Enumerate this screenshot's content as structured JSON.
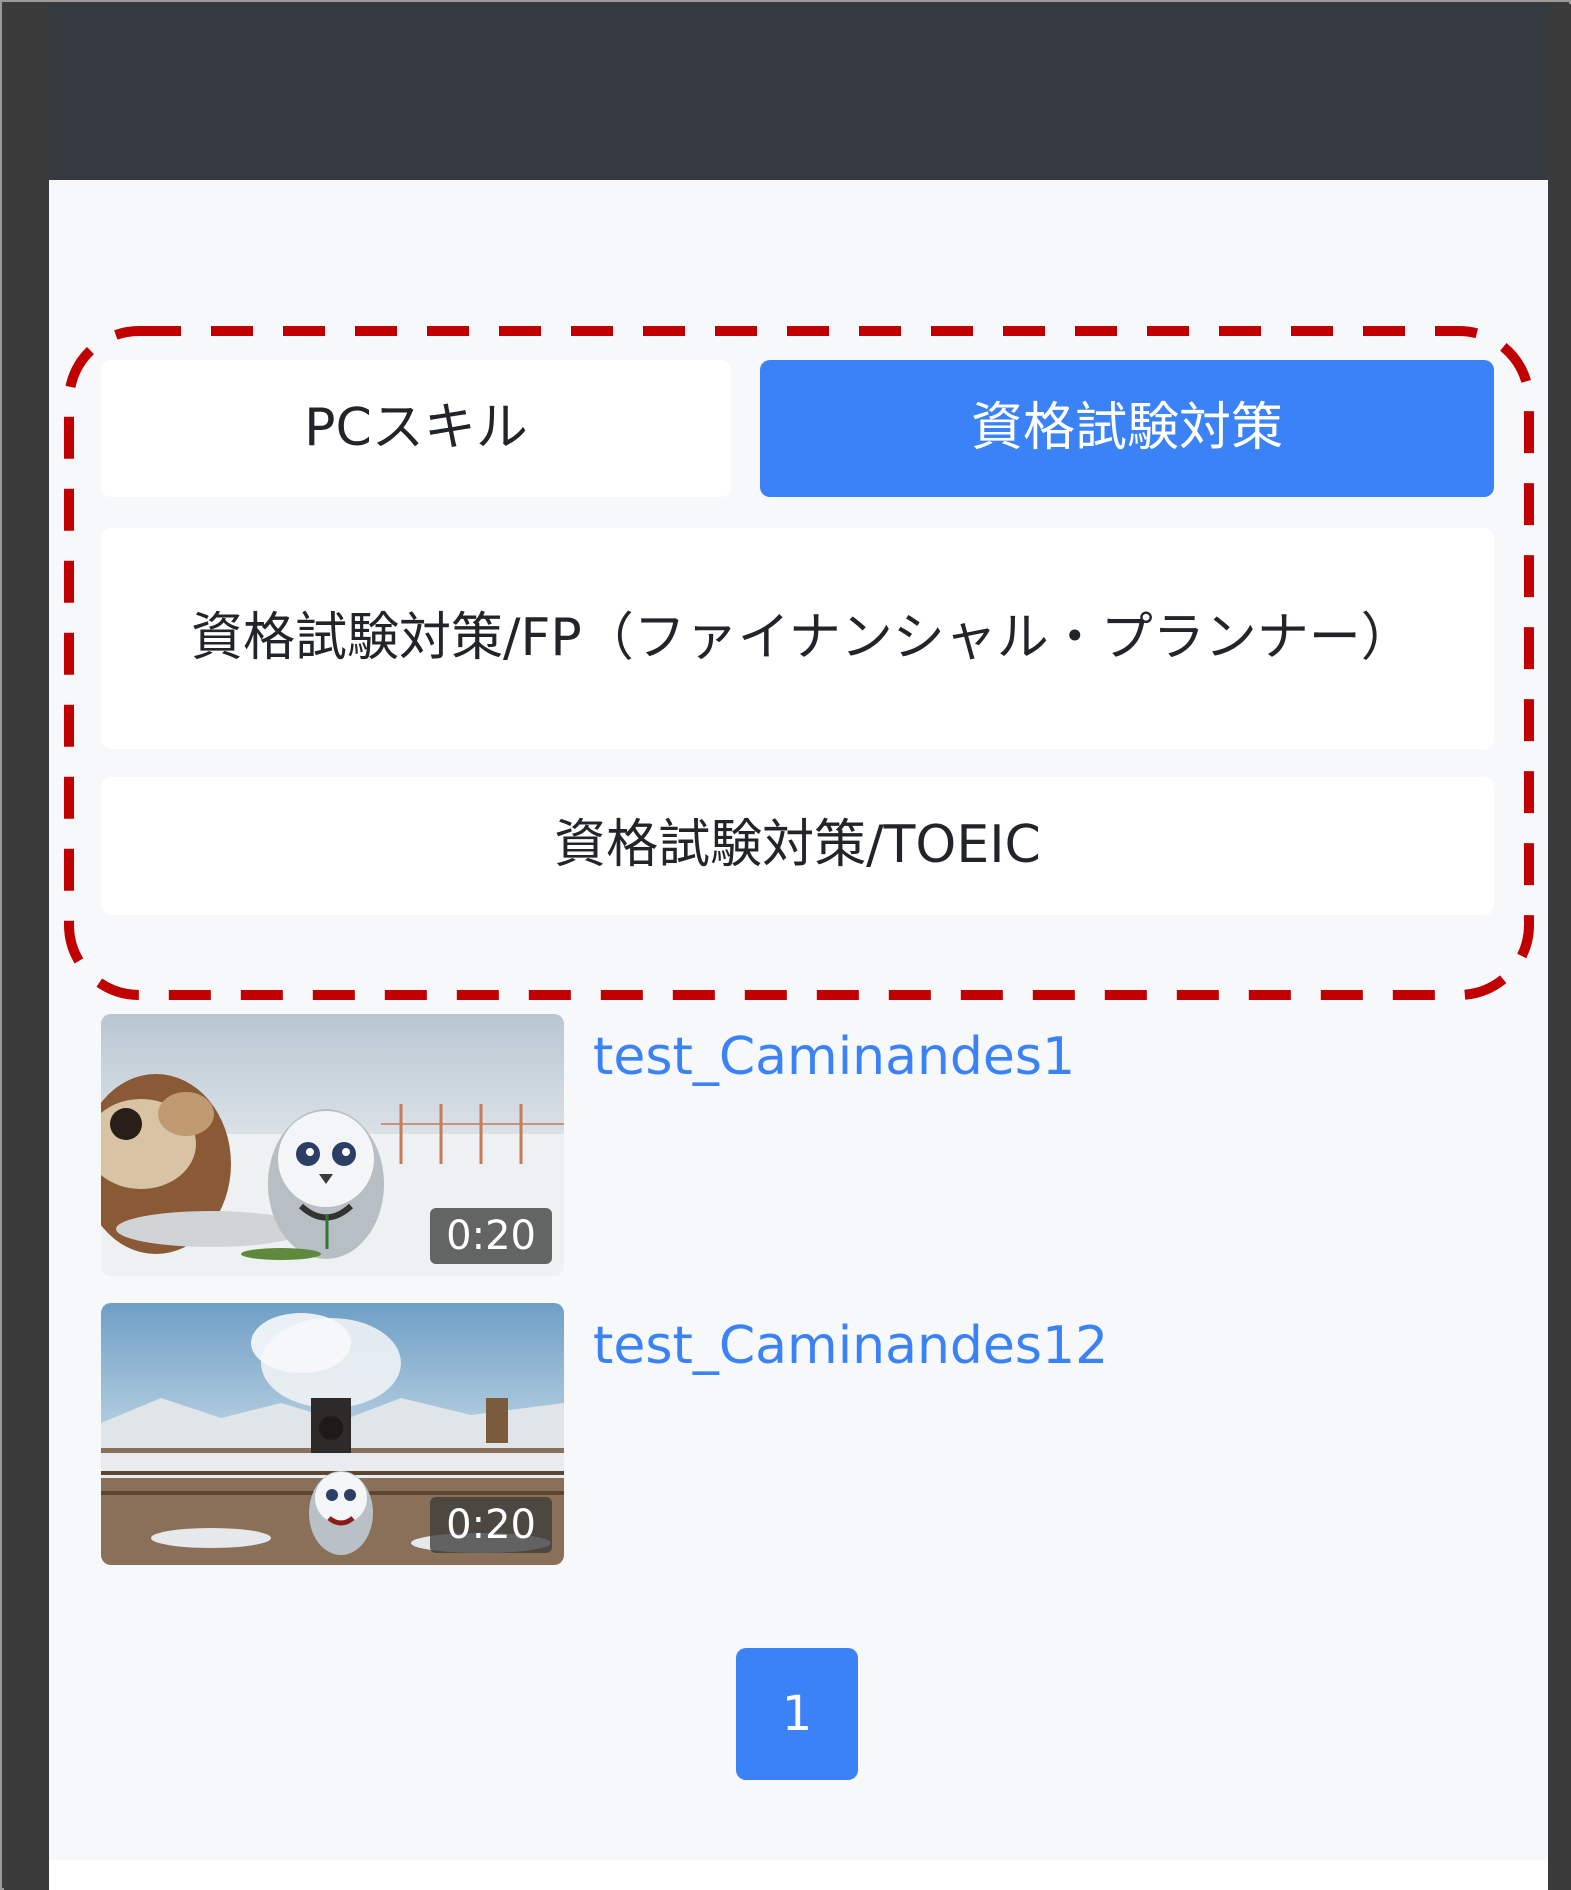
{
  "tabs": [
    {
      "label": "PCスキル",
      "active": false
    },
    {
      "label": "資格試験対策",
      "active": true
    }
  ],
  "subcategories": [
    {
      "label": "資格試験対策/FP（ファイナンシャル・プランナー）"
    },
    {
      "label": "資格試験対策/TOEIC"
    }
  ],
  "videos": [
    {
      "title": "test_Caminandes1",
      "duration": "0:20"
    },
    {
      "title": "test_Caminandes12",
      "duration": "0:20"
    }
  ],
  "pagination": {
    "current": "1"
  },
  "colors": {
    "accent": "#3b82f6",
    "navbar": "#343a40",
    "highlight": "#c00000"
  }
}
